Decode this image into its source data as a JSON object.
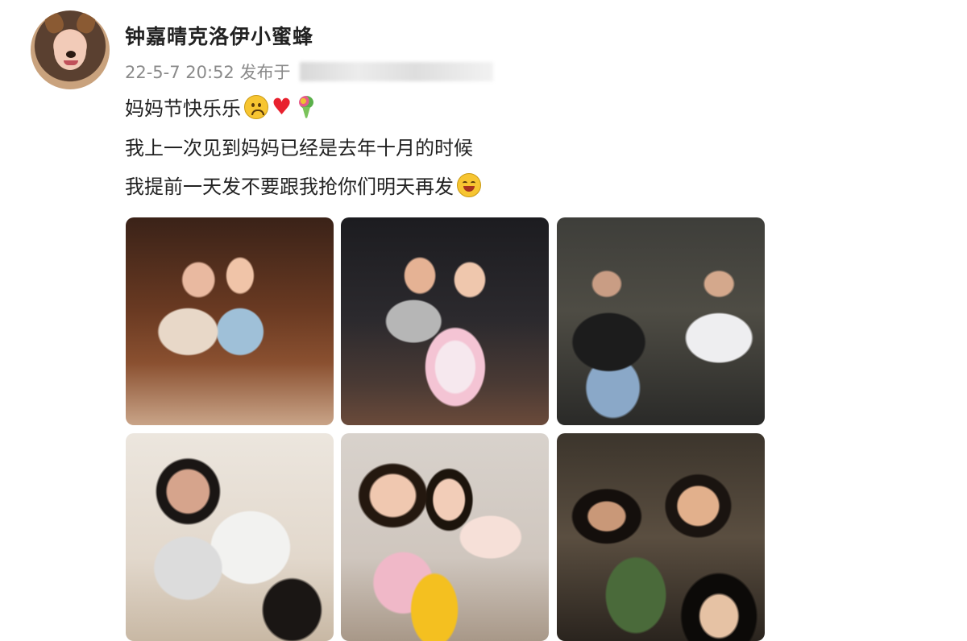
{
  "post": {
    "username": "钟嘉晴克洛伊小蜜蜂",
    "meta": "22-5-7 20:52 发布于",
    "lines": [
      "妈妈节快乐乐",
      "我上一次见到妈妈已经是去年十月的时候",
      "我提前一天发不要跟我抢你们明天再发"
    ],
    "emojis": [
      "sad-face-emoji",
      "heart-emoji",
      "bouquet-emoji",
      "smiling-face-emoji"
    ],
    "photo_count": 6
  },
  "colors": {
    "text": "#222222",
    "meta": "#8a8a8a",
    "heart": "#e8212e"
  }
}
